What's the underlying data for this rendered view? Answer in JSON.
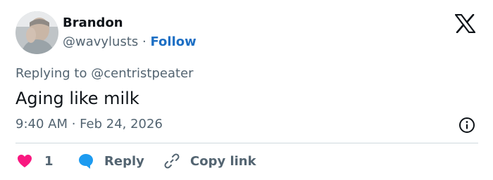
{
  "author": {
    "name": "Brandon",
    "handle": "@wavylusts",
    "separator": "·",
    "follow_label": "Follow"
  },
  "tweet": {
    "replying_to_prefix": "Replying to",
    "replying_to_handle": "@centristpeater",
    "text": "Aging like milk",
    "timestamp": "9:40 AM · Feb 24, 2026"
  },
  "actions": {
    "like_count": "1",
    "reply_label": "Reply",
    "copy_link_label": "Copy link"
  },
  "icons": {
    "logo": "x-logo-icon",
    "info": "info-icon",
    "like": "heart-icon",
    "reply": "speech-bubble-icon",
    "copy": "link-icon"
  },
  "colors": {
    "text": "#0f1419",
    "secondary": "#536471",
    "accent": "#1d6fc4",
    "heart": "#f91880",
    "reply_bubble": "#1d9bf0",
    "divider": "#cfd9de"
  }
}
